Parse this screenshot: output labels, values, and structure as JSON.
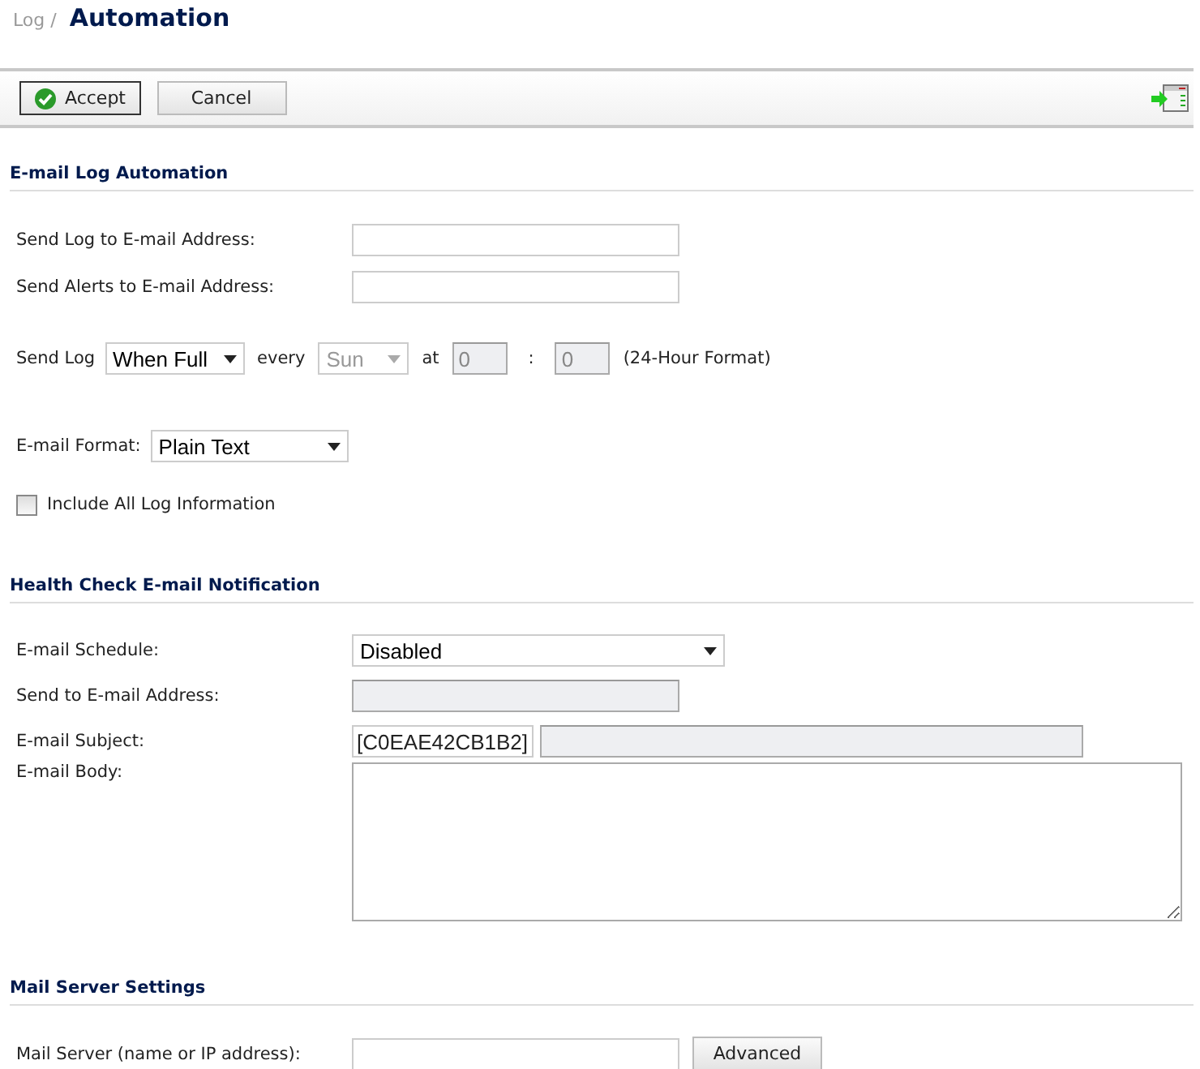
{
  "breadcrumb": {
    "parent": "Log /",
    "title": "Automation"
  },
  "toolbar": {
    "buttons": [
      {
        "label": "Accept",
        "kind": "primary"
      },
      {
        "label": "Cancel",
        "kind": "plain"
      }
    ]
  },
  "email_log": {
    "heading": "E-mail Log Automation",
    "fields": [
      {
        "label": "Send Log to E-mail Address:",
        "disabled": false
      },
      {
        "label": "Send Alerts to E-mail Address:",
        "disabled": false
      }
    ],
    "send_log": {
      "label": "Send Log",
      "frequency": {
        "value": "When Full",
        "disabled": false
      },
      "every_label": "every",
      "day": {
        "value": "Sun",
        "disabled": true
      },
      "at_label": "at",
      "hour": {
        "value": "0",
        "disabled": true
      },
      "separator": ":",
      "minute": {
        "value": "0",
        "disabled": true
      },
      "format_note": "(24-Hour Format)"
    },
    "format": {
      "label": "E-mail Format:",
      "value": "Plain Text",
      "disabled": false
    },
    "include_all": {
      "label": "Include All Log Information",
      "checked": false
    }
  },
  "health_check": {
    "heading": "Health Check E-mail Notification",
    "schedule": {
      "label": "E-mail Schedule:",
      "value": "Disabled",
      "disabled": false
    },
    "send_to": {
      "label": "Send to E-mail Address:",
      "disabled": true
    },
    "subject": {
      "label": "E-mail Subject:",
      "prefix": "[C0EAE42CB1B2]",
      "disabled": true
    },
    "body": {
      "label": "E-mail Body:"
    }
  },
  "mail_server": {
    "heading": "Mail Server Settings",
    "label": "Mail Server (name or IP address):",
    "button": "Advanced"
  }
}
